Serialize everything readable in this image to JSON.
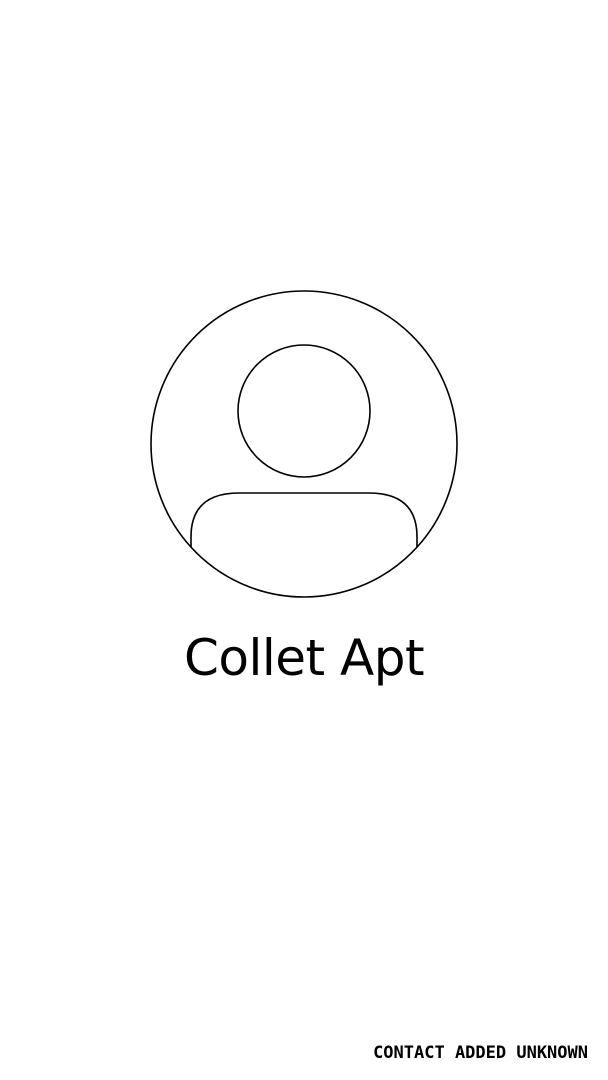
{
  "contact": {
    "name": "Collet Apt",
    "avatar_icon": "person-avatar-icon"
  },
  "footer": {
    "status": "CONTACT ADDED UNKNOWN"
  },
  "colors": {
    "background": "#ffffff",
    "text": "#000000",
    "outline": "#000000"
  }
}
